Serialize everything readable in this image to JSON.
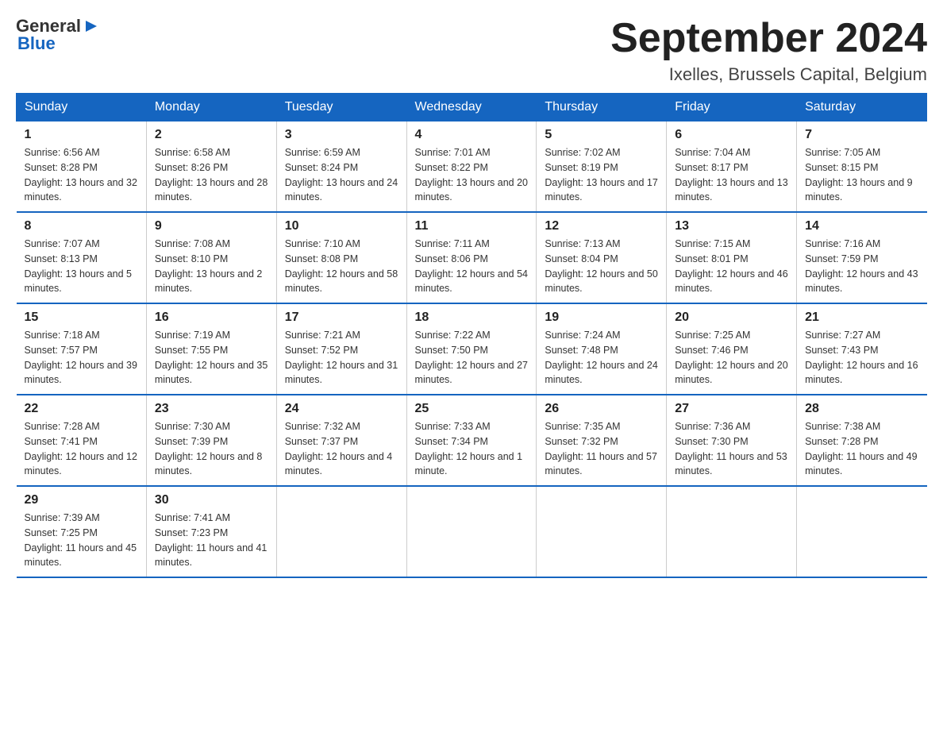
{
  "logo": {
    "general": "General",
    "blue": "Blue",
    "triangle_symbol": "▶"
  },
  "header": {
    "month_year": "September 2024",
    "location": "Ixelles, Brussels Capital, Belgium"
  },
  "days_of_week": [
    "Sunday",
    "Monday",
    "Tuesday",
    "Wednesday",
    "Thursday",
    "Friday",
    "Saturday"
  ],
  "weeks": [
    [
      {
        "day": "1",
        "sunrise": "6:56 AM",
        "sunset": "8:28 PM",
        "daylight": "13 hours and 32 minutes."
      },
      {
        "day": "2",
        "sunrise": "6:58 AM",
        "sunset": "8:26 PM",
        "daylight": "13 hours and 28 minutes."
      },
      {
        "day": "3",
        "sunrise": "6:59 AM",
        "sunset": "8:24 PM",
        "daylight": "13 hours and 24 minutes."
      },
      {
        "day": "4",
        "sunrise": "7:01 AM",
        "sunset": "8:22 PM",
        "daylight": "13 hours and 20 minutes."
      },
      {
        "day": "5",
        "sunrise": "7:02 AM",
        "sunset": "8:19 PM",
        "daylight": "13 hours and 17 minutes."
      },
      {
        "day": "6",
        "sunrise": "7:04 AM",
        "sunset": "8:17 PM",
        "daylight": "13 hours and 13 minutes."
      },
      {
        "day": "7",
        "sunrise": "7:05 AM",
        "sunset": "8:15 PM",
        "daylight": "13 hours and 9 minutes."
      }
    ],
    [
      {
        "day": "8",
        "sunrise": "7:07 AM",
        "sunset": "8:13 PM",
        "daylight": "13 hours and 5 minutes."
      },
      {
        "day": "9",
        "sunrise": "7:08 AM",
        "sunset": "8:10 PM",
        "daylight": "13 hours and 2 minutes."
      },
      {
        "day": "10",
        "sunrise": "7:10 AM",
        "sunset": "8:08 PM",
        "daylight": "12 hours and 58 minutes."
      },
      {
        "day": "11",
        "sunrise": "7:11 AM",
        "sunset": "8:06 PM",
        "daylight": "12 hours and 54 minutes."
      },
      {
        "day": "12",
        "sunrise": "7:13 AM",
        "sunset": "8:04 PM",
        "daylight": "12 hours and 50 minutes."
      },
      {
        "day": "13",
        "sunrise": "7:15 AM",
        "sunset": "8:01 PM",
        "daylight": "12 hours and 46 minutes."
      },
      {
        "day": "14",
        "sunrise": "7:16 AM",
        "sunset": "7:59 PM",
        "daylight": "12 hours and 43 minutes."
      }
    ],
    [
      {
        "day": "15",
        "sunrise": "7:18 AM",
        "sunset": "7:57 PM",
        "daylight": "12 hours and 39 minutes."
      },
      {
        "day": "16",
        "sunrise": "7:19 AM",
        "sunset": "7:55 PM",
        "daylight": "12 hours and 35 minutes."
      },
      {
        "day": "17",
        "sunrise": "7:21 AM",
        "sunset": "7:52 PM",
        "daylight": "12 hours and 31 minutes."
      },
      {
        "day": "18",
        "sunrise": "7:22 AM",
        "sunset": "7:50 PM",
        "daylight": "12 hours and 27 minutes."
      },
      {
        "day": "19",
        "sunrise": "7:24 AM",
        "sunset": "7:48 PM",
        "daylight": "12 hours and 24 minutes."
      },
      {
        "day": "20",
        "sunrise": "7:25 AM",
        "sunset": "7:46 PM",
        "daylight": "12 hours and 20 minutes."
      },
      {
        "day": "21",
        "sunrise": "7:27 AM",
        "sunset": "7:43 PM",
        "daylight": "12 hours and 16 minutes."
      }
    ],
    [
      {
        "day": "22",
        "sunrise": "7:28 AM",
        "sunset": "7:41 PM",
        "daylight": "12 hours and 12 minutes."
      },
      {
        "day": "23",
        "sunrise": "7:30 AM",
        "sunset": "7:39 PM",
        "daylight": "12 hours and 8 minutes."
      },
      {
        "day": "24",
        "sunrise": "7:32 AM",
        "sunset": "7:37 PM",
        "daylight": "12 hours and 4 minutes."
      },
      {
        "day": "25",
        "sunrise": "7:33 AM",
        "sunset": "7:34 PM",
        "daylight": "12 hours and 1 minute."
      },
      {
        "day": "26",
        "sunrise": "7:35 AM",
        "sunset": "7:32 PM",
        "daylight": "11 hours and 57 minutes."
      },
      {
        "day": "27",
        "sunrise": "7:36 AM",
        "sunset": "7:30 PM",
        "daylight": "11 hours and 53 minutes."
      },
      {
        "day": "28",
        "sunrise": "7:38 AM",
        "sunset": "7:28 PM",
        "daylight": "11 hours and 49 minutes."
      }
    ],
    [
      {
        "day": "29",
        "sunrise": "7:39 AM",
        "sunset": "7:25 PM",
        "daylight": "11 hours and 45 minutes."
      },
      {
        "day": "30",
        "sunrise": "7:41 AM",
        "sunset": "7:23 PM",
        "daylight": "11 hours and 41 minutes."
      },
      null,
      null,
      null,
      null,
      null
    ]
  ]
}
